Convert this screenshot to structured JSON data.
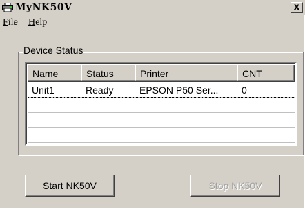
{
  "window": {
    "title": "MyNK50V",
    "close_glyph": "x",
    "icon": "printer-icon"
  },
  "menu": {
    "file_first": "F",
    "file_rest": "ile",
    "help_first": "H",
    "help_rest": "elp"
  },
  "device_status": {
    "label": "Device Status",
    "columns": [
      "Name",
      "Status",
      "Printer",
      "CNT"
    ],
    "rows": [
      {
        "name": "Unit1",
        "status": "Ready",
        "printer": "EPSON P50 Ser...",
        "cnt": "0"
      },
      {
        "name": "",
        "status": "",
        "printer": "",
        "cnt": ""
      },
      {
        "name": "",
        "status": "",
        "printer": "",
        "cnt": ""
      },
      {
        "name": "",
        "status": "",
        "printer": "",
        "cnt": ""
      }
    ]
  },
  "buttons": {
    "start": "Start NK50V",
    "stop": "Stop NK50V",
    "stop_enabled": false
  },
  "colors": {
    "face": "#d4d0c8",
    "disabled_text": "#a0a0a0"
  }
}
